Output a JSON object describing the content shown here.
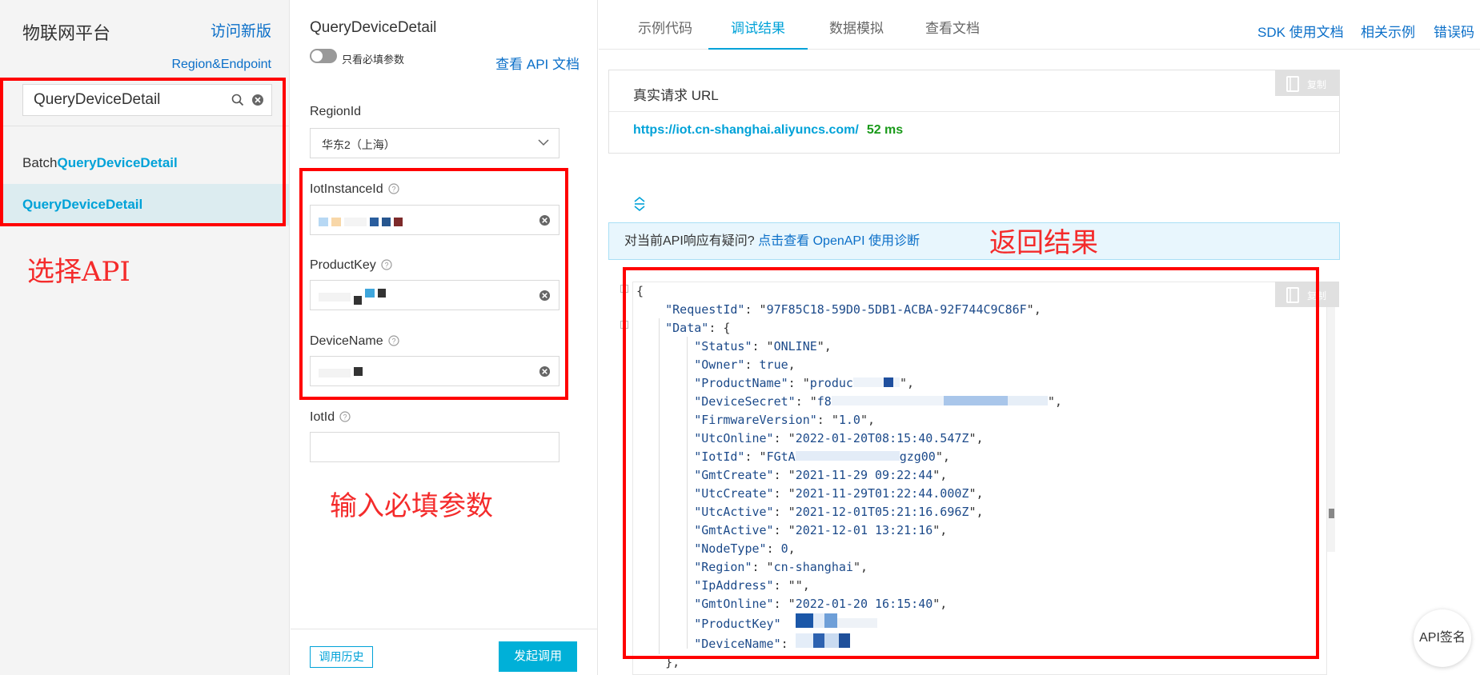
{
  "sidebar": {
    "brand": "物联网平台",
    "visit_new": "访问新版",
    "region_link": "Region&Endpoint",
    "search_value": "QueryDeviceDetail",
    "items": [
      {
        "prefix": "Batch",
        "match": "QueryDeviceDetail"
      },
      {
        "prefix": "",
        "match": "QueryDeviceDetail"
      }
    ]
  },
  "params": {
    "api_title": "QueryDeviceDetail",
    "toggle_label": "只看必填参数",
    "api_doc_link": "查看 API 文档",
    "region_label": "RegionId",
    "region_value": "华东2（上海）",
    "iot_instance_label": "IotInstanceId",
    "product_key_label": "ProductKey",
    "device_name_label": "DeviceName",
    "iot_id_label": "IotId",
    "history_button": "调用历史",
    "invoke_button": "发起调用"
  },
  "tabs": [
    {
      "label": "示例代码",
      "active": false
    },
    {
      "label": "调试结果",
      "active": true
    },
    {
      "label": "数据模拟",
      "active": false
    },
    {
      "label": "查看文档",
      "active": false
    }
  ],
  "right_links": [
    "SDK 使用文档",
    "相关示例",
    "错误码"
  ],
  "request": {
    "title": "真实请求 URL",
    "copy_label": "复制",
    "url": "https://iot.cn-shanghai.aliyuncs.com/",
    "duration": "52 ms"
  },
  "diagnose": {
    "text": "对当前API响应有疑问?",
    "link": "点击查看 OpenAPI 使用诊断"
  },
  "result": {
    "copy_label": "复制",
    "request_id": "97F85C18-59D0-5DB1-ACBA-92F744C9C86F",
    "status": "ONLINE",
    "owner": "true",
    "product_name_visible": "produc",
    "device_secret_visible": "f8",
    "firmware_version": "1.0",
    "utc_online": "2022-01-20T08:15:40.547Z",
    "iot_id_start": "FGtA",
    "iot_id_end": "gzg00",
    "gmt_create": "2021-11-29 09:22:44",
    "utc_create": "2021-11-29T01:22:44.000Z",
    "utc_active": "2021-12-01T05:21:16.696Z",
    "gmt_active": "2021-12-01 13:21:16",
    "node_type": "0",
    "region": "cn-shanghai",
    "ip_address": "",
    "gmt_online": "2022-01-20 16:15:40",
    "code": ""
  },
  "annotations": {
    "select_api": "选择API",
    "input_params": "输入必填参数",
    "return_result": "返回结果"
  },
  "sign_button": "API签名",
  "colors": {
    "accent": "#00a2d8",
    "link": "#0b6fc8",
    "annotation_red": "#f00",
    "success": "#1a9a1a"
  }
}
